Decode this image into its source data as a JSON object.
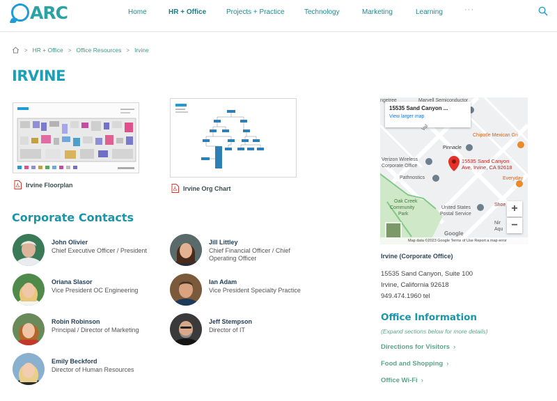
{
  "header": {
    "logo_text": "ARC",
    "nav": [
      {
        "label": "Home",
        "active": false
      },
      {
        "label": "HR + Office",
        "active": true
      },
      {
        "label": "Projects + Practice",
        "active": false
      },
      {
        "label": "Technology",
        "active": false
      },
      {
        "label": "Marketing",
        "active": false
      },
      {
        "label": "Learning",
        "active": false
      }
    ],
    "more_label": "···"
  },
  "breadcrumb": [
    "HR + Office",
    "Office Resources",
    "Irvine"
  ],
  "page_title": "IRVINE",
  "documents": [
    {
      "label": "Irvine Floorplan"
    },
    {
      "label": "Irvine Org Chart"
    }
  ],
  "contacts_title": "Corporate Contacts",
  "contacts": [
    {
      "name": "John Olivier",
      "role": "Chief Executive Officer / President"
    },
    {
      "name": "Jill Littley",
      "role": "Chief Financial Officer / Chief Operating Officer"
    },
    {
      "name": "Oriana Slasor",
      "role": "Vice President OC Engineering"
    },
    {
      "name": "Ian Adam",
      "role": "Vice President Specialty Practice"
    },
    {
      "name": "Robin Robinson",
      "role": "Principal / Director of Marketing"
    },
    {
      "name": "Jeff Stempson",
      "role": "Director of IT"
    },
    {
      "name": "Emily Beckford",
      "role": "Director of Human Resources"
    }
  ],
  "map": {
    "info_address": "15535 Sand Canyon ...",
    "info_link": "View larger map",
    "pin_label_1": "15535 Sand Canyon",
    "pin_label_2": "Ave, Irvine, CA 92618",
    "labels": {
      "marvell": "Marvell Semiconductor",
      "getree": "ngetree",
      "chipotle": "Chipotle Mexican Gri",
      "pinnacle": "Pinnacle",
      "verizon_1": "Verizon Wireless",
      "verizon_2": "Corporate Office",
      "pathnostics": "Pathnostics",
      "everyday": "Everyday",
      "oak_1": "Oak Creek",
      "oak_2": "Community",
      "oak_3": "Park",
      "usps_1": "United States",
      "usps_2": "Postal Service",
      "shoe": "Shoe",
      "water_1": "Nir",
      "water_2": "Aqu",
      "val": "Val",
      "google": "Google"
    },
    "zoom_in": "+",
    "zoom_out": "−",
    "footer": "Map data ©2023 Google    Terms of Use    Report a map error"
  },
  "office": {
    "heading": "Irvine (Corporate Office)",
    "address_1": "15535 Sand Canyon, Suite 100",
    "address_2": "Irvine, California 92618",
    "phone": "949.474.1960 tel"
  },
  "office_info": {
    "title": "Office Information",
    "hint": "(Expand sections below for more details)",
    "links": [
      "Directions for Visitors",
      "Food and Shopping",
      "Office Wi-Fi"
    ]
  },
  "colors": {
    "brand_teal": "#1aa0b8",
    "link_green": "#5aa58c",
    "nav_teal": "#1f8a8c",
    "map_pin_red": "#e3312a"
  }
}
